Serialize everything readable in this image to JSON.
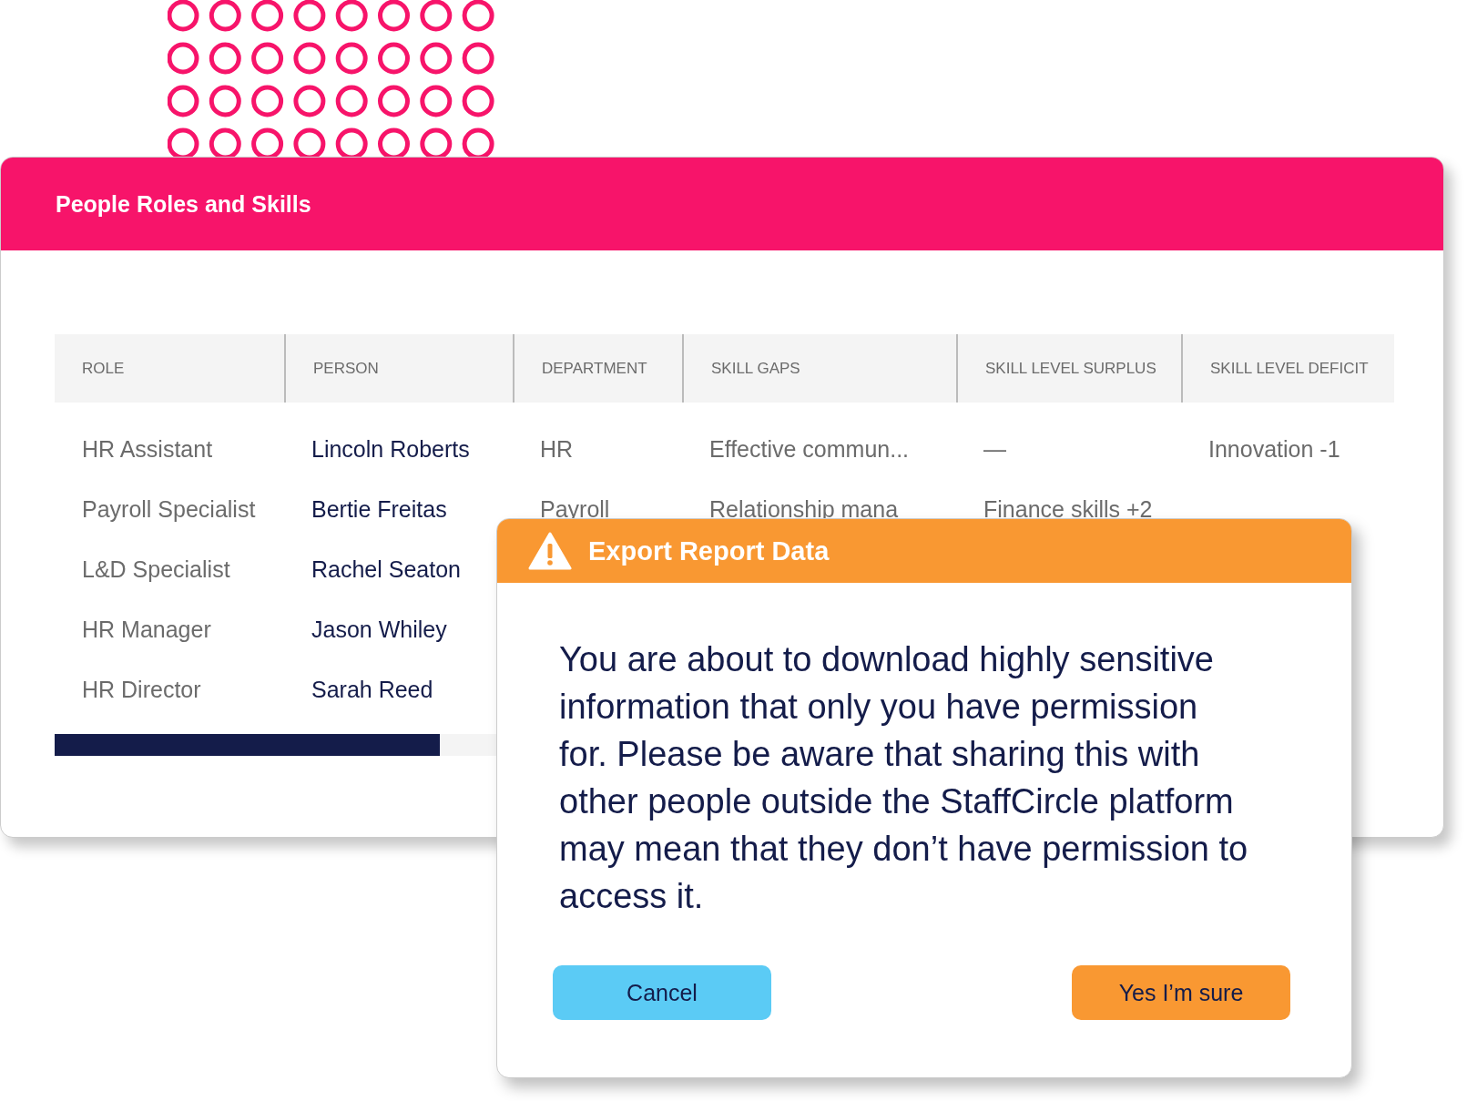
{
  "card": {
    "title": "People Roles and Skills"
  },
  "table": {
    "columns": [
      "ROLE",
      "PERSON",
      "DEPARTMENT",
      "SKILL GAPS",
      "SKILL LEVEL SURPLUS",
      "SKILL LEVEL DEFICIT"
    ],
    "rows": [
      {
        "role": "HR Assistant",
        "person": "Lincoln Roberts",
        "department": "HR",
        "skill_gaps": "Effective commun...",
        "skill_level_surplus": "—",
        "skill_level_deficit": "Innovation -1"
      },
      {
        "role": "Payroll Specialist",
        "person": "Bertie Freitas",
        "department": "Payroll",
        "skill_gaps": "Relationship mana",
        "skill_level_surplus": "Finance skills +2"
      },
      {
        "role": "L&D Specialist",
        "person": "Rachel Seaton"
      },
      {
        "role": "HR Manager",
        "person": "Jason Whiley"
      },
      {
        "role": "HR Director",
        "person": "Sarah Reed"
      }
    ]
  },
  "dialog": {
    "title": "Export Report Data",
    "message": "You are about to download highly sensitive information that only you have permission for. Please be aware that sharing this with other people outside the StaffCircle platform may mean that they don’t have permission to access it.",
    "buttons": [
      {
        "label": "Cancel",
        "kind": "secondary"
      },
      {
        "label": "Yes I’m sure",
        "kind": "primary"
      }
    ]
  }
}
